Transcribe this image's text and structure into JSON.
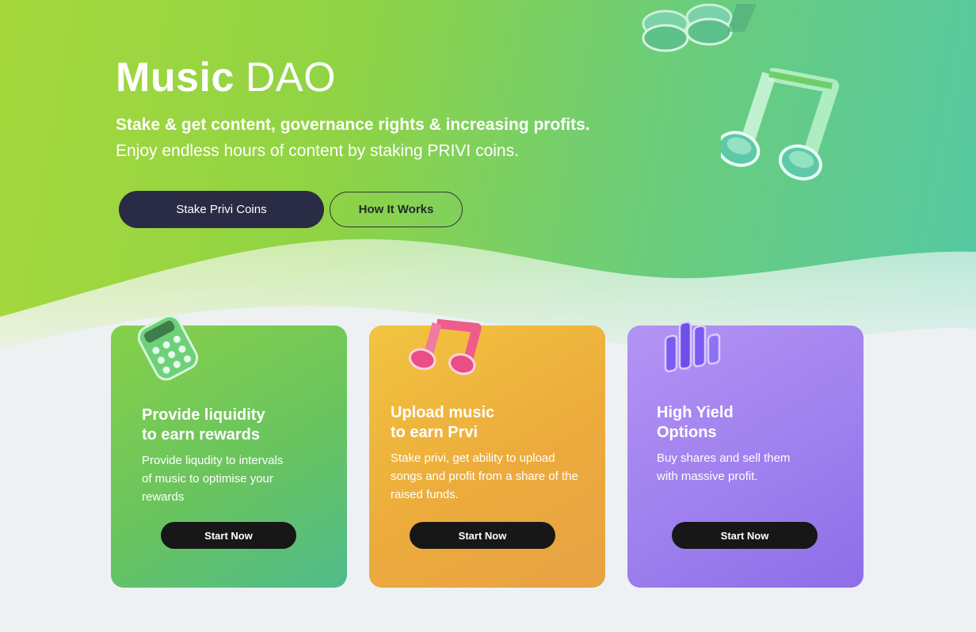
{
  "hero": {
    "title_bold": "Music",
    "title_light": "DAO",
    "subtitle": "Stake & get content, governance rights & increasing profits.",
    "tagline": "Enjoy endless hours of content by staking PRIVI coins.",
    "primary_button": "Stake Privi Coins",
    "secondary_button": "How It Works"
  },
  "cards": [
    {
      "title": "Provide liquidity\nto earn rewards",
      "description": "Provide liqudity to intervals of music to optimise your rewards",
      "button": "Start Now",
      "icon": "calculator-icon",
      "color": "#6cc55a"
    },
    {
      "title": "Upload music\nto earn Prvi",
      "description": "Stake privi, get ability to upload songs and profit from a share of the raised funds.",
      "button": "Start Now",
      "icon": "music-note-icon",
      "color": "#ecae3e"
    },
    {
      "title": "High Yield\nOptions",
      "description": "Buy shares and sell them with massive profit.",
      "button": "Start Now",
      "icon": "chart-bars-icon",
      "color": "#a083ef"
    }
  ],
  "colors": {
    "hero_start": "#a6d83c",
    "hero_end": "#55c8a4",
    "primary_button": "#2a2b44",
    "card_button": "#171717",
    "page_background": "#eef1f4"
  }
}
